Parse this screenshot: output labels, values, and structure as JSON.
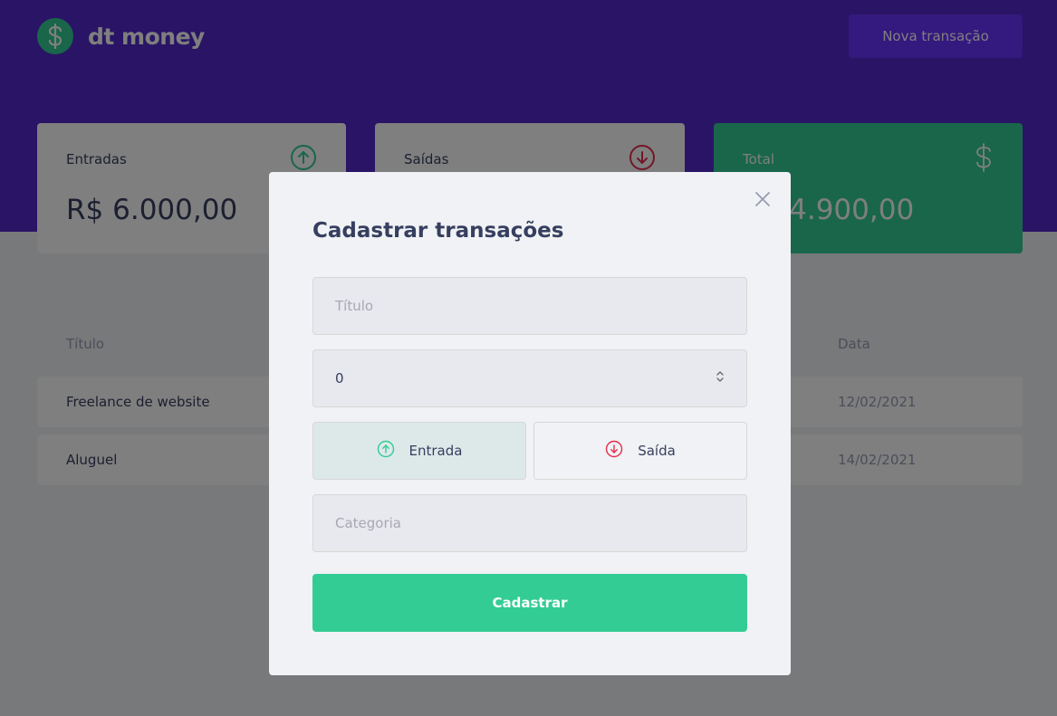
{
  "app": {
    "name": "dt money",
    "new_transaction_label": "Nova transação"
  },
  "summary": {
    "income": {
      "label": "Entradas",
      "value": "R$ 6.000,00"
    },
    "outcome": {
      "label": "Saídas",
      "value": ""
    },
    "total": {
      "label": "Total",
      "value": "4.900,00"
    }
  },
  "table": {
    "columns": [
      "Título",
      "Data"
    ],
    "rows": [
      {
        "title": "Freelance de website",
        "date": "12/02/2021"
      },
      {
        "title": "Aluguel",
        "date": "14/02/2021"
      }
    ]
  },
  "modal": {
    "title": "Cadastrar transações",
    "title_placeholder": "Título",
    "amount_value": "0",
    "type_income_label": "Entrada",
    "type_outcome_label": "Saída",
    "category_placeholder": "Categoria",
    "submit_label": "Cadastrar"
  },
  "colors": {
    "header": "#5429cc",
    "button": "#6933ff",
    "green": "#33cc95",
    "red": "#e52e4d",
    "text": "#363f5f"
  }
}
